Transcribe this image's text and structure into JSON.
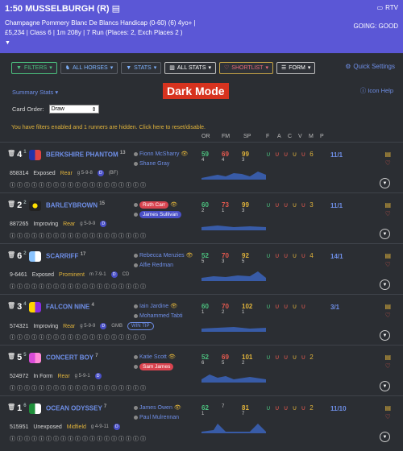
{
  "header": {
    "title": "1:50 MUSSELBURGH (R)",
    "rtv": "RTV",
    "race_line1": "Champagne Pommery Blanc De Blancs Handicap (0-60) (6) 4yo+ |",
    "race_line2": "£5,234 | Class 6 | 1m 208y | 7 Run (Places: 2, Exch Places 2 )",
    "going": "GOING: GOOD"
  },
  "toolbar": {
    "filters": "FILTERS",
    "all_horses": "ALL HORSES",
    "stats": "STATS",
    "all_stats": "ALL STATS",
    "shortlist": "SHORTLIST",
    "form": "FORM",
    "quick_settings": "Quick Settings"
  },
  "summary_stats": "Summary Stats",
  "dark_mode": "Dark Mode",
  "icon_help": "Icon Help",
  "card_order": {
    "label": "Card Order:",
    "value": "Draw"
  },
  "filter_note": "You have filters enabled and 1 runners are hidden. Click here to reset/disable.",
  "columns": [
    "OR",
    "FM",
    "SP",
    "F",
    "A",
    "C",
    "V",
    "M",
    "P"
  ],
  "runners": [
    {
      "num": "4",
      "draw": "1",
      "name": "BERKSHIRE PHANTOM",
      "age": "13",
      "jockey": "Fionn McSharry",
      "trainer": "Shane Gray",
      "or": "59",
      "or_sub": "4",
      "fm": "69",
      "fm_sub": "4",
      "sp": "99",
      "sp_sub": "3",
      "shoe6": "6",
      "odds": "11/1",
      "id": "858314",
      "status": "Exposed",
      "style": "Rear",
      "gear": "g 5-9-8",
      "extra": "(BF)"
    },
    {
      "num": "2",
      "draw": "2",
      "name": "BARLEYBROWN",
      "age": "15",
      "jockey": "Ruth Carr",
      "trainer": "James Sullivan",
      "or": "60",
      "or_sub": "2",
      "fm": "73",
      "fm_sub": "1",
      "sp": "99",
      "sp_sub": "3",
      "shoe6": "3",
      "odds": "11/1",
      "id": "887265",
      "status": "Improving",
      "style": "Rear",
      "gear": "g 5-9-9",
      "extra": ""
    },
    {
      "num": "6",
      "draw": "2",
      "name": "SCARRIFF",
      "age": "17",
      "jockey": "Rebecca Menzies",
      "trainer": "Alfie Redman",
      "or": "52",
      "or_sub": "5",
      "fm": "70",
      "fm_sub": "3",
      "sp": "92",
      "sp_sub": "5",
      "shoe6": "4",
      "odds": "14/1",
      "id": "9-6461",
      "status": "Exposed",
      "style": "Prominent",
      "gear": "m 7-9-1",
      "extra": "CD"
    },
    {
      "num": "3",
      "draw": "4",
      "name": "FALCON NINE",
      "age": "4",
      "jockey": "Iain Jardine",
      "trainer": "Mohammed Tabti",
      "or": "60",
      "or_sub": "1",
      "fm": "70",
      "fm_sub": "2",
      "sp": "102",
      "sp_sub": "1",
      "shoe6": "",
      "odds": "3/1",
      "id": "574321",
      "status": "Improving",
      "style": "Rear",
      "gear": "g 5-9-9",
      "extra": "GMB",
      "wintip": "WIN TIP"
    },
    {
      "num": "5",
      "draw": "5",
      "name": "CONCERT BOY",
      "age": "7",
      "jockey": "Katie Scott",
      "trainer": "Sam James",
      "or": "52",
      "or_sub": "6",
      "fm": "69",
      "fm_sub": "5",
      "sp": "101",
      "sp_sub": "2",
      "shoe6": "2",
      "odds": "",
      "id": "524972",
      "status": "In Form",
      "style": "Rear",
      "gear": "g 5-9-1",
      "extra": ""
    },
    {
      "num": "1",
      "draw": "6",
      "name": "OCEAN ODYSSEY",
      "age": "7",
      "jockey": "James Owen",
      "trainer": "Paul Mulrennan",
      "or": "62",
      "or_sub": "1",
      "fm": "",
      "fm_sub": "7",
      "sp": "81",
      "sp_sub": "7",
      "shoe6": "2",
      "odds": "11/10",
      "id": "515951",
      "status": "Unexposed",
      "style": "Midfield",
      "gear": "g 4-9-11",
      "extra": ""
    }
  ],
  "colors": {
    "header": "#5b57d6",
    "bg": "#2b2e33",
    "accent": "#6f8fe8",
    "green": "#4bc07e",
    "red": "#e85a4f",
    "yellow": "#e0b33b"
  }
}
